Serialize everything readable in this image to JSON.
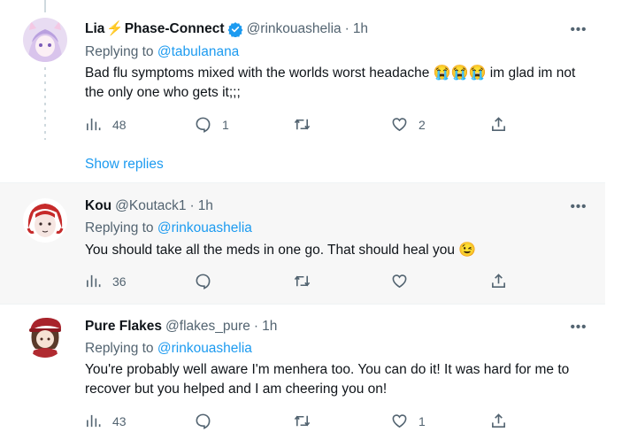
{
  "tweets": [
    {
      "name": "Lia",
      "name_suffix": "Phase-Connect",
      "bolt": "⚡",
      "handle": "@rinkouashelia",
      "dot": "·",
      "time": "1h",
      "replying_label": "Replying to",
      "replying_to": "@tabulanana",
      "text_before": "Bad flu symptoms mixed with the worlds worst headache",
      "emoji": "😭😭😭",
      "text_after": "im glad im not the only one who gets it;;;",
      "views": "48",
      "replies": "1",
      "retweets": "",
      "likes": "2",
      "show_replies": "Show replies"
    },
    {
      "name": "Kou",
      "handle": "@Koutack1",
      "dot": "·",
      "time": "1h",
      "replying_label": "Replying to",
      "replying_to": "@rinkouashelia",
      "text": "You should take all the meds in one go. That should heal you",
      "emoji": "😉",
      "views": "36",
      "replies": "",
      "retweets": "",
      "likes": ""
    },
    {
      "name": "Pure Flakes",
      "handle": "@flakes_pure",
      "dot": "·",
      "time": "1h",
      "replying_label": "Replying to",
      "replying_to": "@rinkouashelia",
      "text": "You're probably well aware I'm menhera too. You can do it! It was hard for me to recover but you helped and I am cheering you on!",
      "views": "43",
      "replies": "",
      "retweets": "",
      "likes": "1"
    }
  ],
  "more_glyph": "•••",
  "colors": {
    "link": "#1d9bf0",
    "muted": "#536471",
    "text": "#0f1419",
    "hover_bg": "#f7f7f7",
    "verified": "#1d9bf0"
  }
}
